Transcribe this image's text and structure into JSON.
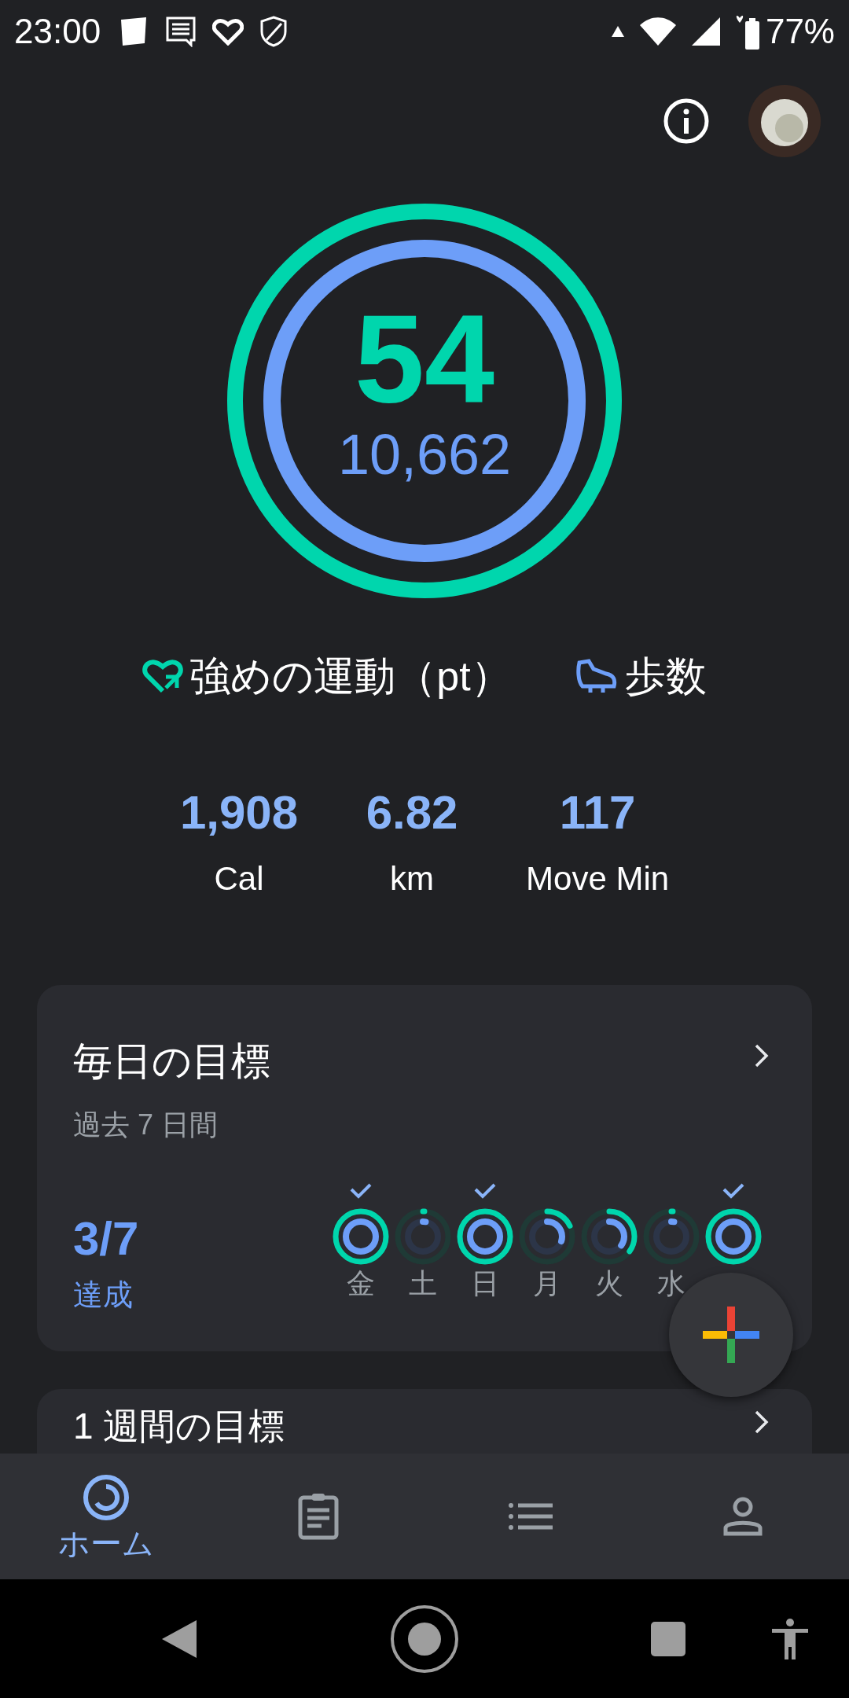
{
  "status_bar": {
    "time": "23:00",
    "battery": "77%"
  },
  "summary": {
    "points": "54",
    "steps": "10,662",
    "rings": [
      {
        "level": 1
      },
      {
        "level": 1
      }
    ]
  },
  "legend": [
    {
      "kind": "heart",
      "label": "強めの運動（pt）"
    },
    {
      "kind": "steps",
      "label": "歩数"
    }
  ],
  "stats": [
    {
      "value": "1,908",
      "label": "Cal"
    },
    {
      "value": "6.82",
      "label": "km"
    },
    {
      "value": "117",
      "label": "Move Min"
    }
  ],
  "daily_goals": {
    "title": "毎日の目標",
    "subtitle": "過去 7 日間",
    "achieved": "3/7",
    "achieved_label": "達成",
    "days": [
      {
        "label": "金",
        "checked": true,
        "rings": [
          {
            "level": 1
          },
          {
            "level": 1
          }
        ]
      },
      {
        "label": "土",
        "checked": false,
        "rings": [
          {
            "level": 0.01
          },
          {
            "level": 0.03
          }
        ]
      },
      {
        "label": "日",
        "checked": true,
        "rings": [
          {
            "level": 1
          },
          {
            "level": 1
          }
        ]
      },
      {
        "label": "月",
        "checked": false,
        "rings": [
          {
            "level": 0.18
          },
          {
            "level": 0.3
          }
        ]
      },
      {
        "label": "火",
        "checked": false,
        "rings": [
          {
            "level": 0.35
          },
          {
            "level": 0.35
          }
        ]
      },
      {
        "label": "水",
        "checked": false,
        "rings": [
          {
            "level": 0.01
          },
          {
            "level": 0.03
          }
        ]
      },
      {
        "checked": true,
        "rings": [
          {
            "level": 1
          },
          {
            "level": 1
          }
        ]
      }
    ]
  },
  "weekly_goals": {
    "title": "1 週間の目標"
  },
  "bottom_nav": [
    {
      "kind": "home",
      "label": "ホーム",
      "selected": true
    },
    {
      "kind": "journal",
      "selected": false
    },
    {
      "kind": "browse",
      "selected": false
    },
    {
      "kind": "profile",
      "selected": false
    }
  ]
}
